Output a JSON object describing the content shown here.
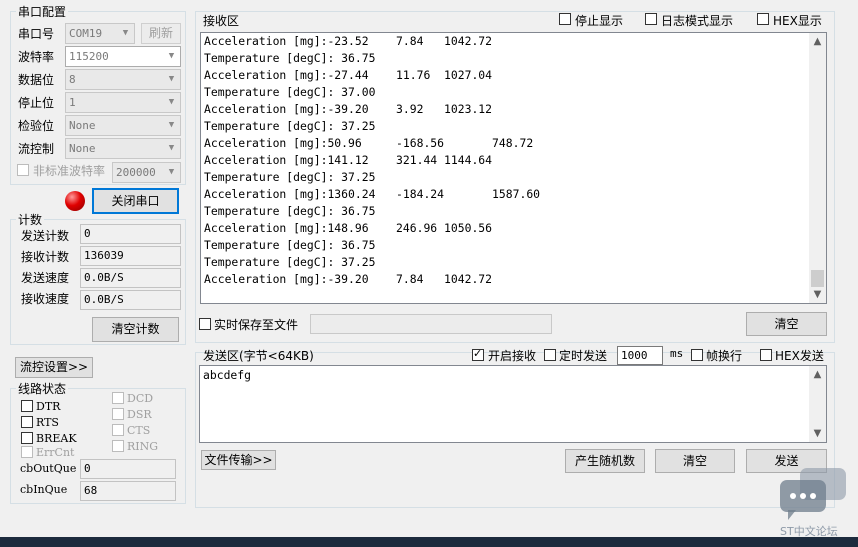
{
  "serial_config": {
    "title": "串口配置",
    "port_label": "串口号",
    "port_value": "COM19",
    "refresh_label": "刷新",
    "baud_label": "波特率",
    "baud_value": "115200",
    "databits_label": "数据位",
    "databits_value": "8",
    "stopbits_label": "停止位",
    "stopbits_value": "1",
    "parity_label": "检验位",
    "parity_value": "None",
    "flow_label": "流控制",
    "flow_value": "None",
    "nonstd_label": "非标准波特率",
    "nonstd_value": "200000",
    "close_port_label": "关闭串口",
    "indicator_color": "#e00000"
  },
  "counts": {
    "title": "计数",
    "send_count_label": "发送计数",
    "send_count": "0",
    "recv_count_label": "接收计数",
    "recv_count": "136039",
    "send_speed_label": "发送速度",
    "send_speed": "0.0B/S",
    "recv_speed_label": "接收速度",
    "recv_speed": "0.0B/S",
    "clear_label": "清空计数"
  },
  "flow_settings_label": "流控设置>>",
  "line_status": {
    "title": "线路状态",
    "dtr": "DTR",
    "rts": "RTS",
    "brk": "BREAK",
    "errcnt": "ErrCnt",
    "dcd": "DCD",
    "dsr": "DSR",
    "cts": "CTS",
    "ring": "RING",
    "cbout_label": "cbOutQue",
    "cbout_value": "0",
    "cbin_label": "cbInQue",
    "cbin_value": "68"
  },
  "receive": {
    "title": "接收区",
    "stop_display": "停止显示",
    "log_mode": "日志模式显示",
    "hex_display": "HEX显示",
    "lines": [
      "Acceleration [mg]:-23.52    7.84   1042.72",
      "Temperature [degC]: 36.75",
      "Acceleration [mg]:-27.44    11.76  1027.04",
      "Temperature [degC]: 37.00",
      "Acceleration [mg]:-39.20    3.92   1023.12",
      "Temperature [degC]: 37.25",
      "Acceleration [mg]:50.96     -168.56       748.72",
      "Acceleration [mg]:141.12    321.44 1144.64",
      "Temperature [degC]: 37.25",
      "Acceleration [mg]:1360.24   -184.24       1587.60",
      "Temperature [degC]: 36.75",
      "Acceleration [mg]:148.96    246.96 1050.56",
      "Temperature [degC]: 36.75",
      "Temperature [degC]: 37.25",
      "Acceleration [mg]:-39.20    7.84   1042.72"
    ],
    "save_to_file": "实时保存至文件",
    "clear_label": "清空"
  },
  "send": {
    "title": "发送区(字节<64KB)",
    "enable_recv": "开启接收",
    "timed_send": "定时发送",
    "interval_value": "1000",
    "interval_unit": "ms",
    "newline": "帧换行",
    "hex_send": "HEX发送",
    "content": "abcdefg",
    "file_transfer": "文件传输>>",
    "random_label": "产生随机数",
    "clear_label": "清空",
    "send_label": "发送"
  },
  "watermark": "ST中文论坛"
}
